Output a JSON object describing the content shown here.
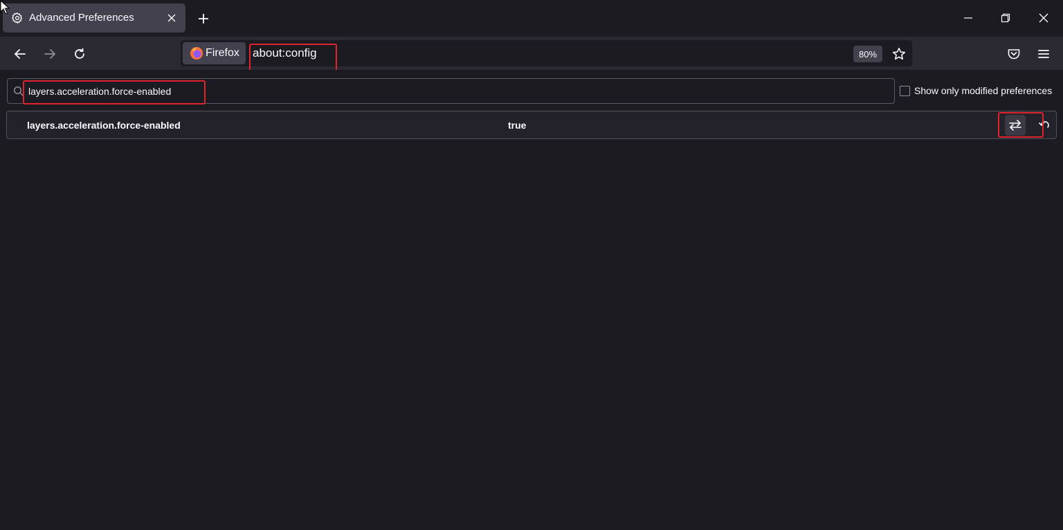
{
  "tab": {
    "title": "Advanced Preferences",
    "icon": "gear-icon"
  },
  "window_controls": [
    "minimize-icon",
    "restore-icon",
    "close-icon"
  ],
  "navbar": {
    "identity_label": "Firefox",
    "url": "about:config",
    "zoom": "80%"
  },
  "search": {
    "value": "layers.acceleration.force-enabled"
  },
  "filter": {
    "label": "Show only modified preferences",
    "checked": false
  },
  "preferences": [
    {
      "name": "layers.acceleration.force-enabled",
      "value": "true"
    }
  ],
  "colors": {
    "background": "#1c1b22",
    "toolbar": "#2b2a33",
    "tab_selected": "#42414d",
    "annotation_highlight": "#e0232e"
  }
}
